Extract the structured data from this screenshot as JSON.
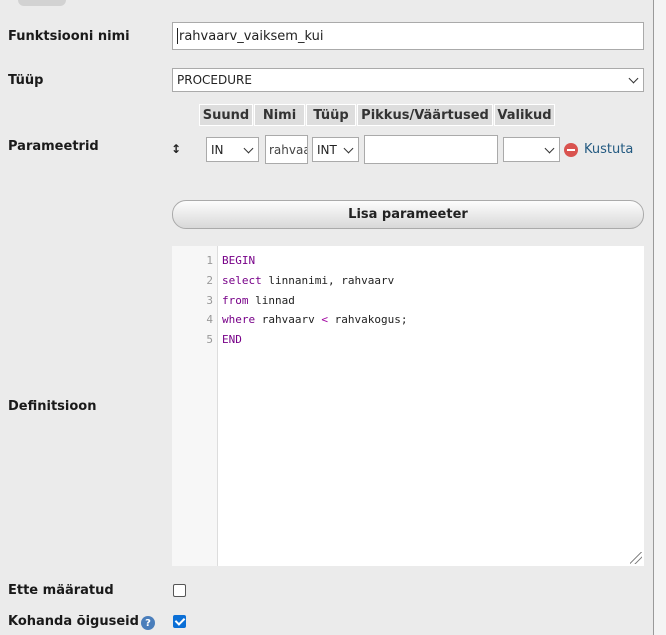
{
  "form": {
    "function_name_label": "Funktsiooni nimi",
    "function_name_value": "rahvaarv_vaiksem_kui",
    "type_label": "Tüüp",
    "type_value": "PROCEDURE",
    "parameters_label": "Parameetrid",
    "parameter_headers": [
      "Suund",
      "Nimi",
      "Tüüp",
      "Pikkus/Väärtused",
      "Valikud"
    ],
    "parameter_row": {
      "direction": "IN",
      "name": "rahvaarv",
      "type": "INT",
      "length": "",
      "options": "",
      "delete_label": "Kustuta"
    },
    "add_parameter_label": "Lisa parameeter",
    "definition_label": "Definitsioon",
    "definition_lines": [
      {
        "num": "1",
        "text": "BEGIN"
      },
      {
        "num": "2",
        "text": "select linnanimi, rahvaarv"
      },
      {
        "num": "3",
        "text": "from linnad"
      },
      {
        "num": "4",
        "text": "where rahvaarv < rahvakogus;"
      },
      {
        "num": "5",
        "text": "END"
      }
    ],
    "deterministic_label": "Ette määratud",
    "deterministic_checked": false,
    "adjust_privileges_label": "Kohanda õiguseid",
    "adjust_privileges_checked": true
  },
  "colors": {
    "keyword": "#770088",
    "delete_icon": "#d9534f",
    "checkbox_checked": "#0b6fd6",
    "help_icon": "#4a7ebb"
  },
  "icons": {
    "sort_handle": "up-down-arrow-icon",
    "delete": "red-minus-circle-icon",
    "help": "question-help-icon"
  }
}
